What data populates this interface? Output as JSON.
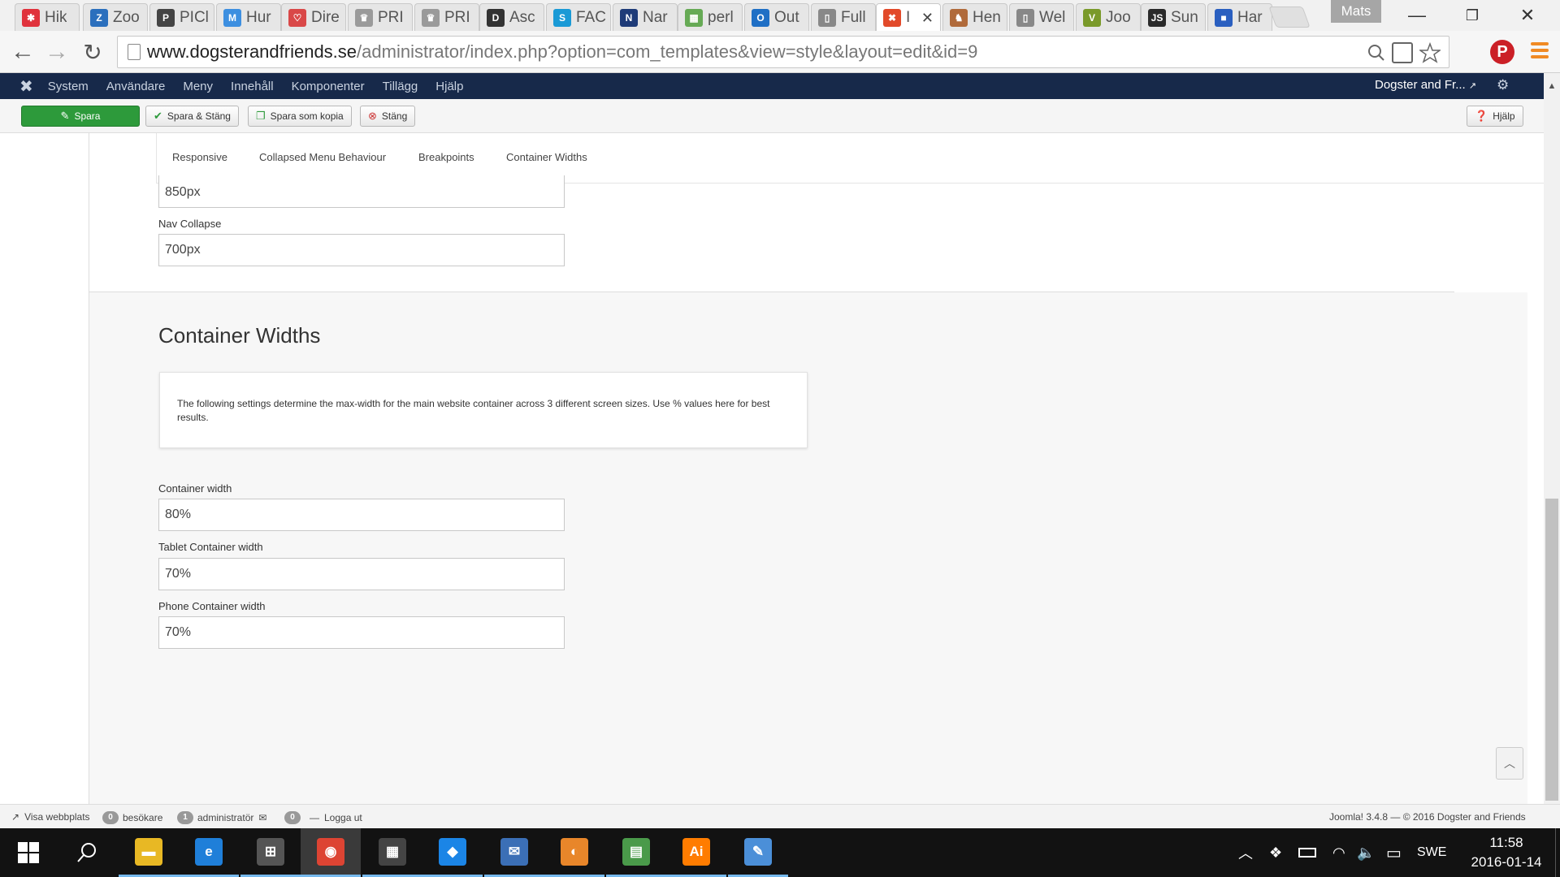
{
  "browser": {
    "tabs": [
      {
        "label": "Hik",
        "color": "#e0323c",
        "glyph": "✱"
      },
      {
        "label": "Zoo",
        "color": "#2b6fbd",
        "glyph": "Z"
      },
      {
        "label": "PICl",
        "color": "#444444",
        "glyph": "P"
      },
      {
        "label": "Hur",
        "color": "#3d8fe0",
        "glyph": "M"
      },
      {
        "label": "Dire",
        "color": "#d94848",
        "glyph": "♡"
      },
      {
        "label": "PRI",
        "color": "#9a9a9a",
        "glyph": "♛"
      },
      {
        "label": "PRI",
        "color": "#9a9a9a",
        "glyph": "♛"
      },
      {
        "label": "Asc",
        "color": "#333333",
        "glyph": "D"
      },
      {
        "label": "FAC",
        "color": "#1a9ad6",
        "glyph": "S"
      },
      {
        "label": "Nar",
        "color": "#1e3b78",
        "glyph": "N"
      },
      {
        "label": "perl",
        "color": "#66aa55",
        "glyph": "▦"
      },
      {
        "label": "Out",
        "color": "#1f6fc5",
        "glyph": "O"
      },
      {
        "label": "Full",
        "color": "#888888",
        "glyph": "▯"
      },
      {
        "label": "I",
        "color": "#e24a2a",
        "glyph": "✖",
        "active": true
      },
      {
        "label": "Hen",
        "color": "#b06a3a",
        "glyph": "♞"
      },
      {
        "label": "Wel",
        "color": "#888888",
        "glyph": "▯"
      },
      {
        "label": "Joo",
        "color": "#7a9a2a",
        "glyph": "V"
      },
      {
        "label": "Sun",
        "color": "#2a2a2a",
        "glyph": "JS"
      },
      {
        "label": "Har",
        "color": "#2a5fc0",
        "glyph": "■"
      }
    ],
    "user": "Mats",
    "tab_close": "✕",
    "window": {
      "minimize": "—",
      "restore": "❐",
      "close": "✕"
    },
    "url_host": "www.dogsterandfriends.se",
    "url_path": "/administrator/index.php?option=com_templates&view=style&layout=edit&id=9",
    "nav": {
      "back": "←",
      "forward": "→",
      "reload": "↻"
    }
  },
  "joomla_nav": {
    "logo": "✖",
    "items": [
      "System",
      "Användare",
      "Meny",
      "Innehåll",
      "Komponenter",
      "Tillägg",
      "Hjälp"
    ],
    "site_link": "Dogster and Fr...",
    "settings": "⚙"
  },
  "toolbar": {
    "save": "Spara",
    "save_close": "Spara & Stäng",
    "save_copy": "Spara som kopia",
    "close": "Stäng",
    "help": "Hjälp"
  },
  "tabs": [
    "Responsive",
    "Collapsed Menu Behaviour",
    "Breakpoints",
    "Container Widths"
  ],
  "section1": {
    "field_top_value": "850px",
    "nav_collapse_label": "Nav Collapse",
    "nav_collapse_value": "700px"
  },
  "section2": {
    "title": "Container Widths",
    "info": "The following settings determine the max-width for the main website container across 3 different screen sizes. Use % values here for best results.",
    "fields": [
      {
        "label": "Container width",
        "value": "80%"
      },
      {
        "label": "Tablet Container width",
        "value": "70%"
      },
      {
        "label": "Phone Container width",
        "value": "70%"
      }
    ]
  },
  "statusbar": {
    "view_site": "Visa webbplats",
    "visitors_count": "0",
    "visitors_label": "besökare",
    "admin_count": "1",
    "admin_label": "administratör",
    "messages_count": "0",
    "logout": "Logga ut",
    "footer": "Joomla! 3.4.8  —  © 2016 Dogster and Friends"
  },
  "taskbar": {
    "apps": [
      {
        "name": "file-explorer",
        "glyph": "▬",
        "color": "#e8b824"
      },
      {
        "name": "edge",
        "glyph": "e",
        "color": "#1f7fd9"
      },
      {
        "name": "store",
        "glyph": "⊞",
        "color": "#555555"
      },
      {
        "name": "chrome",
        "glyph": "◉",
        "color": "#dd4433",
        "active": true
      },
      {
        "name": "calculator",
        "glyph": "▦",
        "color": "#444444"
      },
      {
        "name": "dropbox",
        "glyph": "◆",
        "color": "#1b85e6"
      },
      {
        "name": "thunderbird",
        "glyph": "✉",
        "color": "#3b6fb6"
      },
      {
        "name": "app-orange",
        "glyph": "◐",
        "color": "#e8862a"
      },
      {
        "name": "sheet-app",
        "glyph": "▤",
        "color": "#4a9a4a"
      },
      {
        "name": "illustrator",
        "glyph": "Ai",
        "color": "#ff7c00"
      },
      {
        "name": "paint",
        "glyph": "✎",
        "color": "#4b8fd8"
      }
    ],
    "language": "SWE",
    "time": "11:58",
    "date": "2016-01-14"
  }
}
